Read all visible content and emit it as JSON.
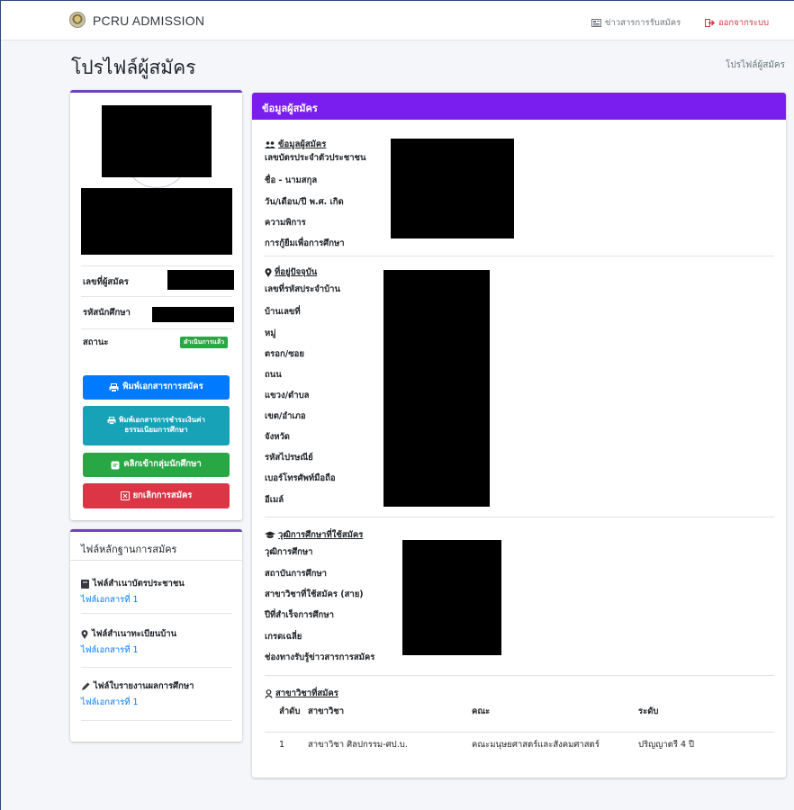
{
  "navbar": {
    "brand": "PCRU ADMISSION",
    "news_label": "ข่าวสารการรับสมัคร",
    "logout_label": "ออกจากระบบ"
  },
  "page": {
    "title": "โปรไฟล์ผู้สมัคร",
    "breadcrumb": "โปรไฟล์ผู้สมัคร"
  },
  "profile": {
    "applicant_no_label": "เลขที่ผู้สมัคร",
    "student_id_label": "รหัสนักศึกษา",
    "status_label": "สถานะ",
    "status_badge": "ดำเนินการแล้ว",
    "buttons": {
      "print_application": "พิมพ์เอกสารการสมัคร",
      "print_fee_line1": "พิมพ์เอกสารการชำระเงินค่า",
      "print_fee_line2": "ธรรมเนียมการศึกษา",
      "join_group": "คลิกเข้ากลุ่มนักศึกษา",
      "cancel_application": "ยกเลิกการสมัคร"
    }
  },
  "files": {
    "title": "ไฟล์หลักฐานการสมัคร",
    "items": [
      {
        "title": "ไฟล์สำเนาบัตรประชาชน",
        "link": "ไฟล์เอกสารที่ 1",
        "icon": "book-icon"
      },
      {
        "title": "ไฟล์สำเนาทะเบียนบ้าน",
        "link": "ไฟล์เอกสารที่ 1",
        "icon": "map-marker-icon"
      },
      {
        "title": "ไฟล์ใบรายงานผลการศึกษา",
        "link": "ไฟล์เอกสารที่ 1",
        "icon": "pencil-icon"
      }
    ]
  },
  "main": {
    "header": "ข้อมูลผู้สมัคร",
    "applicant_section": {
      "title": "ข้อมูลผู้สมัคร",
      "fields": [
        "เลขบัตรประจำตัวประชาชน",
        "ชื่อ - นามสกุล",
        "วัน/เดือน/ปี พ.ศ. เกิด",
        "ความพิการ",
        "การกู้ยืมเพื่อการศึกษา"
      ]
    },
    "address_section": {
      "title": "ที่อยู่ปัจจุบัน",
      "fields": [
        "เลขที่รหัสประจำบ้าน",
        "บ้านเลขที่",
        "หมู่",
        "ตรอก/ซอย",
        "ถนน",
        "แขวง/ตำบล",
        "เขต/อำเภอ",
        "จังหวัด",
        "รหัสไปรษณีย์",
        "เบอร์โทรศัพท์มือถือ",
        "อีเมล์"
      ]
    },
    "education_section": {
      "title": "วุฒิการศึกษาที่ใช้สมัคร",
      "fields": [
        "วุฒิการศึกษา",
        "สถาบันการศึกษา",
        "สาขาวิชาที่ใช้สมัคร (สาย)",
        "ปีที่สำเร็จการศึกษา",
        "เกรดเฉลี่ย",
        "ช่องทางรับรู้ข่าวสารการสมัคร"
      ]
    },
    "major_section": {
      "title": "สาขาวิชาที่สมัคร",
      "columns": [
        "ลำดับ",
        "สาขาวิชา",
        "คณะ",
        "ระดับ"
      ],
      "rows": [
        [
          "1",
          "สาขาวิชา ศิลปกรรม-ศป.บ.",
          "คณะมนุษยศาสตร์และสังคมศาสตร์",
          "ปริญญาตรี 4 ปี"
        ]
      ]
    }
  }
}
